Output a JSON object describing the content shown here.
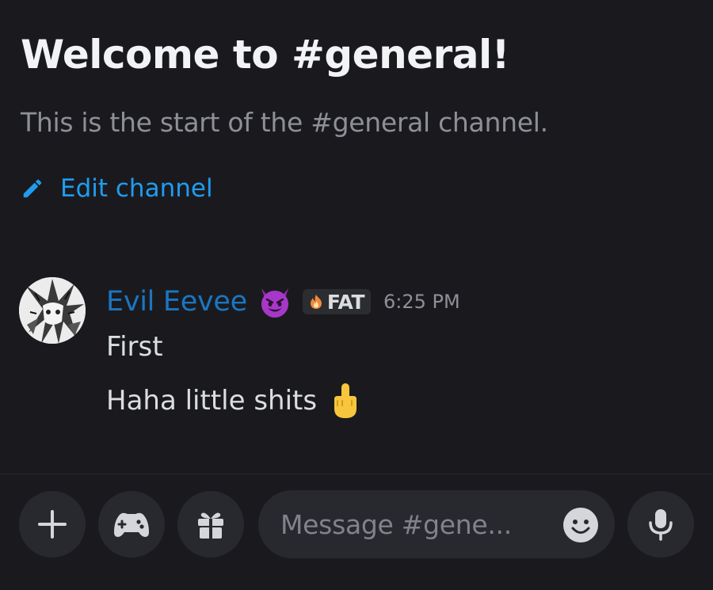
{
  "welcome": {
    "title": "Welcome to #general!",
    "subtitle": "This is the start of the #general channel.",
    "edit_label": "Edit channel"
  },
  "message": {
    "username": "Evil Eevee",
    "status_emoji": "smiling-imp-emoji",
    "tag_icon": "flame-icon",
    "tag": "FAT",
    "timestamp": "6:25 PM",
    "lines": [
      "First",
      "Haha little shits"
    ],
    "line2_emoji": "middle-finger-emoji"
  },
  "composer": {
    "placeholder": "Message #gene..."
  },
  "colors": {
    "background": "#1a1a1e",
    "link": "#1f9cf0",
    "username": "#1b76c2",
    "muted": "#8e9097",
    "button_bg": "#28292e"
  }
}
